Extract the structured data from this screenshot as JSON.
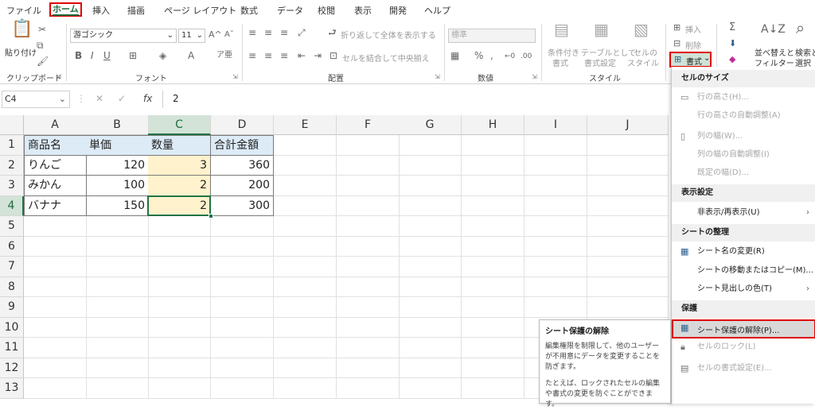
{
  "tabs": [
    "ファイル",
    "ホーム",
    "挿入",
    "描画",
    "ページ レイアウト",
    "数式",
    "データ",
    "校閲",
    "表示",
    "開発",
    "ヘルプ"
  ],
  "ribbon": {
    "clipboard": {
      "paste": "貼り付け",
      "group": "クリップボード"
    },
    "font": {
      "name": "游ゴシック",
      "size": "11",
      "group": "フォント"
    },
    "alignment": {
      "wrap": "折り返して全体を表示する",
      "merge": "セルを結合して中央揃え",
      "group": "配置"
    },
    "number": {
      "format": "標準",
      "group": "数値"
    },
    "style": {
      "conditional_1": "条件付き",
      "conditional_2": "書式",
      "table_1": "テーブルとして",
      "table_2": "書式設定",
      "cell_1": "セルの",
      "cell_2": "スタイル",
      "group": "スタイル"
    },
    "cells": {
      "insert": "挿入",
      "delete": "削除",
      "format": "書式"
    },
    "editing": {
      "sort_1": "並べ替えと",
      "sort_2": "フィルター",
      "find_1": "検索と",
      "find_2": "選択"
    }
  },
  "formula_bar": {
    "name_box": "C4",
    "fx": "fx",
    "value": "2"
  },
  "columns": [
    "A",
    "B",
    "C",
    "D",
    "E",
    "F",
    "G",
    "H",
    "I",
    "J"
  ],
  "rows": [
    "1",
    "2",
    "3",
    "4",
    "5",
    "6",
    "7",
    "8",
    "9",
    "10",
    "11",
    "12",
    "13"
  ],
  "table": {
    "headers": [
      "商品名",
      "単価",
      "数量",
      "合計金額"
    ],
    "data": [
      [
        "りんご",
        "120",
        "3",
        "360"
      ],
      [
        "みかん",
        "100",
        "2",
        "200"
      ],
      [
        "バナナ",
        "150",
        "2",
        "300"
      ]
    ]
  },
  "menu": {
    "cell_size": "セルのサイズ",
    "row_height": "行の高さ(H)...",
    "autofit_row": "行の高さの自動調整(A)",
    "col_width": "列の幅(W)...",
    "autofit_col": "列の幅の自動調整(I)",
    "default_width": "既定の幅(D)...",
    "visibility": "表示設定",
    "hide_unhide": "非表示/再表示(U)",
    "organize": "シートの整理",
    "rename": "シート名の変更(R)",
    "move_copy": "シートの移動またはコピー(M)...",
    "tab_color": "シート見出しの色(T)",
    "protection": "保護",
    "unprotect": "シート保護の解除(P)...",
    "lock_cell": "セルのロック(L)",
    "format_cells": "セルの書式設定(E)..."
  },
  "tooltip": {
    "title": "シート保護の解除",
    "body1": "編集権限を制限して、他のユーザーが不用意にデータを変更することを防ぎます。",
    "body2": "たとえば、ロックされたセルの編集や書式の変更を防ぐことができます。"
  },
  "colors": {
    "accent": "#217346",
    "highlight": "#e00000",
    "header_fill": "#ddebf7",
    "qty_fill": "#fff2cc"
  }
}
